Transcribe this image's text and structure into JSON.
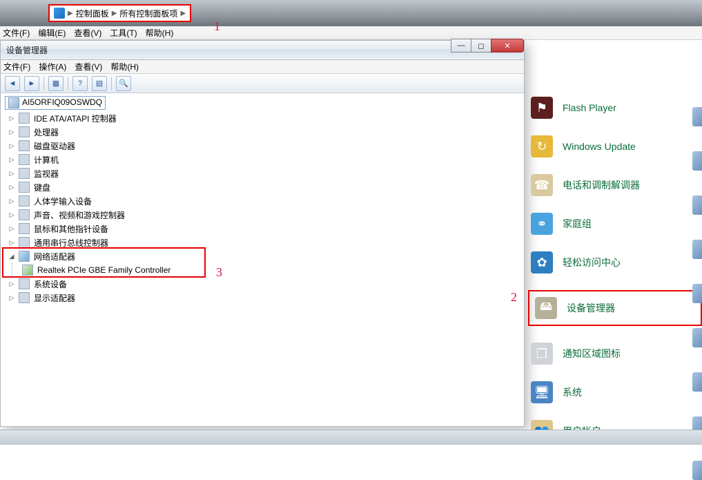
{
  "breadcrumb": {
    "part1": "控制面板",
    "part2": "所有控制面板项"
  },
  "annotations": {
    "a1": "1",
    "a2": "2",
    "a3": "3"
  },
  "menu1": {
    "file": "文件(F)",
    "edit": "编辑(E)",
    "view": "查看(V)",
    "tools": "工具(T)",
    "help": "帮助(H)"
  },
  "devmgr": {
    "title": "设备管理器",
    "menu": {
      "file": "文件(F)",
      "action": "操作(A)",
      "view": "查看(V)",
      "help": "帮助(H)"
    },
    "root": "AI5ORFIQ09OSWDQ",
    "nodes": [
      {
        "label": "IDE ATA/ATAPI 控制器"
      },
      {
        "label": "处理器"
      },
      {
        "label": "磁盘驱动器"
      },
      {
        "label": "计算机"
      },
      {
        "label": "监视器"
      },
      {
        "label": "键盘"
      },
      {
        "label": "人体学输入设备"
      },
      {
        "label": "声音、视频和游戏控制器"
      },
      {
        "label": "鼠标和其他指针设备"
      },
      {
        "label": "通用串行总线控制器"
      }
    ],
    "netAdapter": "网络适配器",
    "netChild": "Realtek PCIe GBE Family Controller",
    "tail": [
      {
        "label": "系统设备"
      },
      {
        "label": "显示适配器"
      }
    ]
  },
  "cp": {
    "items": [
      {
        "label": "Flash Player",
        "iconBg": "#5b1f20",
        "glyph": "⚑"
      },
      {
        "label": "Windows Update",
        "iconBg": "#e8b83a",
        "glyph": "↻"
      },
      {
        "label": "电话和调制解调器",
        "iconBg": "#d9c99f",
        "glyph": "☎"
      },
      {
        "label": "家庭组",
        "iconBg": "#4aa3df",
        "glyph": "⚭"
      },
      {
        "label": "轻松访问中心",
        "iconBg": "#2e7fc1",
        "glyph": "✿"
      },
      {
        "label": "设备管理器",
        "iconBg": "#b7b098",
        "glyph": "🖴",
        "boxed": true
      },
      {
        "label": "通知区域图标",
        "iconBg": "#cfd2d6",
        "glyph": "❐"
      },
      {
        "label": "系统",
        "iconBg": "#4a84c4",
        "glyph": "🖥"
      },
      {
        "label": "用户帐户",
        "iconBg": "#e0c68a",
        "glyph": "👥"
      }
    ]
  }
}
